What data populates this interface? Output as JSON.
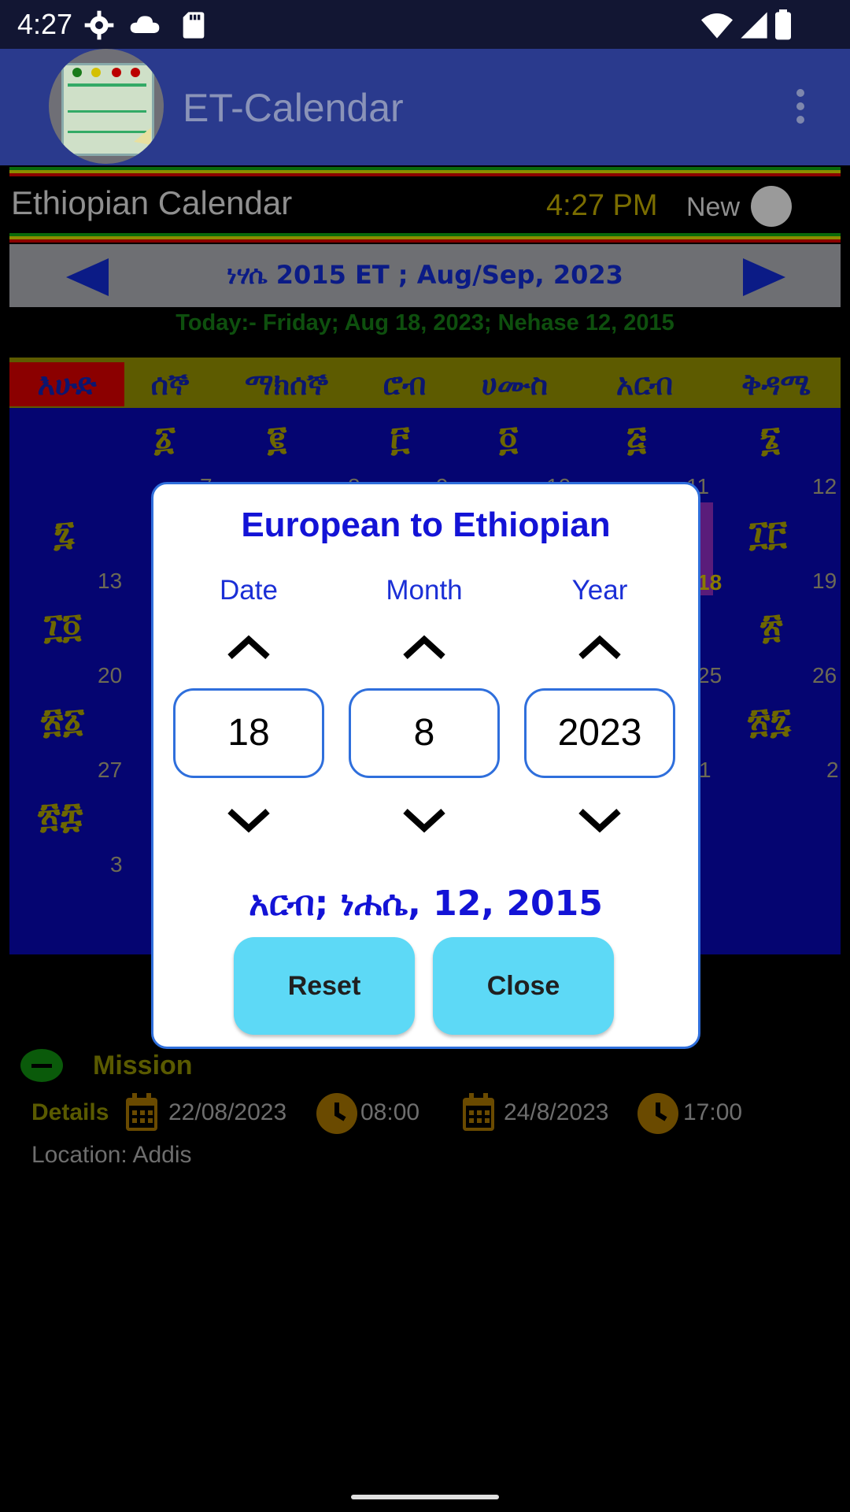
{
  "status_bar": {
    "time": "4:27"
  },
  "app_bar": {
    "title": "ET-Calendar"
  },
  "header": {
    "subtitle": "Ethiopian Calendar",
    "clock": "4:27 PM",
    "new_label": "New"
  },
  "month_nav": {
    "label": "ነሃሴ 2015 ET  ;  Aug/Sep, 2023"
  },
  "today": "Today:-  Friday; Aug 18, 2023; Nehase 12, 2015",
  "weekdays": [
    "እሁድ",
    "ሰኞ",
    "ማክሰኞ",
    "ሮብ",
    "ሀሙስ",
    "አርብ",
    "ቅዳሜ"
  ],
  "calendar_grid": {
    "row1": {
      "geez": [
        "፩",
        "፪",
        "፫",
        "፬",
        "፭",
        "፮"
      ]
    },
    "row2": {
      "geez_left": "፯",
      "geez_right": "፲፫",
      "gregorian_left": "7",
      "gregorian_mid1": "8",
      "gregorian_mid2": "9",
      "gregorian_mid3": "10",
      "gregorian_mid4": "11",
      "gregorian_right": "12"
    },
    "row3": {
      "geez_left": "፲፬",
      "geez_right": "፳",
      "gregorian_left": "13",
      "gregorian_mid": "18",
      "gregorian_right": "19"
    },
    "row4": {
      "geez_left": "፳፩",
      "geez_right": "፳፯",
      "gregorian_left": "20",
      "gregorian_mid": "25",
      "gregorian_right": "26"
    },
    "row5": {
      "geez_left": "፳፰",
      "gregorian_left": "27",
      "gregorian_mid": "1",
      "gregorian_right": "2"
    },
    "row6": {
      "gregorian_left": "3"
    }
  },
  "event": {
    "title": "Mission",
    "details_label": "Details",
    "start_date": "22/08/2023",
    "start_time": "08:00",
    "end_date": "24/8/2023",
    "end_time": "17:00",
    "location": "Location: Addis"
  },
  "dialog": {
    "title": "European to Ethiopian",
    "labels": {
      "date": "Date",
      "month": "Month",
      "year": "Year"
    },
    "values": {
      "date": "18",
      "month": "8",
      "year": "2023"
    },
    "result": "አርብ;  ነሐሴ, 12, 2015",
    "reset_label": "Reset",
    "close_label": "Close"
  },
  "colors": {
    "accent": "#1313d6",
    "button": "#5dd9f6",
    "appbar": "#2a3a8d"
  }
}
